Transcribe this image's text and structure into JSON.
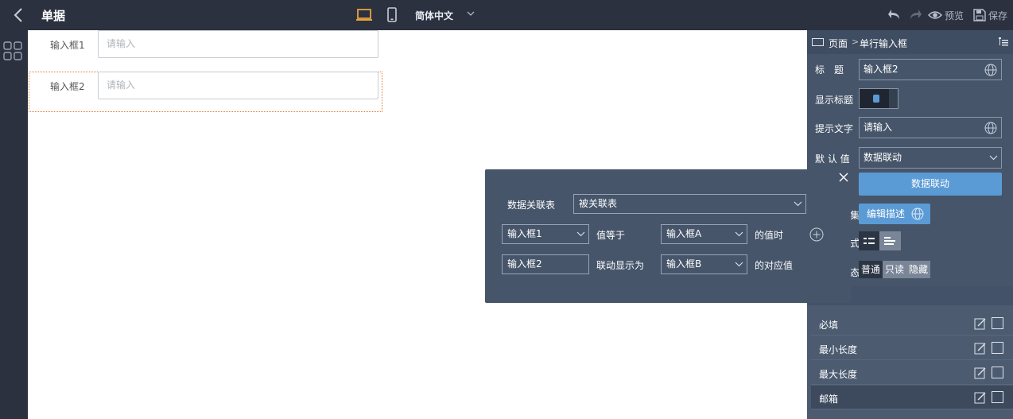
{
  "topbar": {
    "title": "单据",
    "language": "简体中文",
    "preview_label": "预览",
    "save_label": "保存",
    "accent_color": "#e8a23c"
  },
  "canvas": {
    "fields": [
      {
        "label": "输入框1",
        "placeholder": "请输入"
      },
      {
        "label": "输入框2",
        "placeholder": "请输入"
      }
    ]
  },
  "panel": {
    "breadcrumb_root": "页面",
    "breadcrumb_sep": ">",
    "breadcrumb_current": "单行输入框",
    "title_label": "标　题",
    "title_value": "输入框2",
    "show_title_label": "显示标题",
    "hint_label": "提示文字",
    "hint_value": "请输入",
    "default_label": "默 认 值",
    "default_value": "数据联动",
    "linkage_button": "数据联动",
    "edit_desc_button": "编辑描述",
    "partial_label_1": "集",
    "partial_label_2": "式",
    "partial_label_3": "态",
    "state_options": [
      "普通",
      "只读",
      "隐藏"
    ],
    "rules": [
      "必填",
      "最小长度",
      "最大长度",
      "邮箱"
    ],
    "button_color": "#5b9bd5"
  },
  "popup": {
    "table_label": "数据关联表",
    "table_value": "被关联表",
    "row1": {
      "field": "输入框1",
      "op": "值等于",
      "target": "输入框A",
      "suffix": "的值时"
    },
    "row2": {
      "field": "输入框2",
      "op": "联动显示为",
      "target": "输入框B",
      "suffix": "的对应值"
    }
  }
}
